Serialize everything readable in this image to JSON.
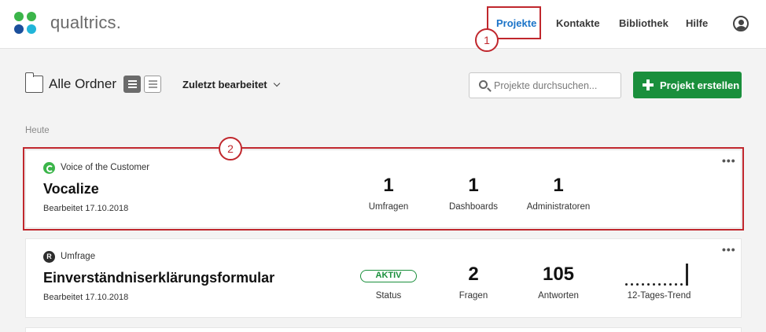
{
  "header": {
    "brand": "qualtrics.",
    "nav": [
      "Projekte",
      "Kontakte",
      "Bibliothek",
      "Hilfe"
    ],
    "active_nav": "Projekte"
  },
  "annotations": {
    "callout1": "1",
    "callout2": "2"
  },
  "toolbar": {
    "folder_label": "Alle Ordner",
    "sort_label": "Zuletzt bearbeitet",
    "search_placeholder": "Projekte durchsuchen...",
    "create_label": "Projekt erstellen"
  },
  "section_label": "Heute",
  "projects": [
    {
      "type_icon": "vocalize-icon",
      "type": "Voice of the Customer",
      "name": "Vocalize",
      "edited": "Bearbeitet 17.10.2018",
      "stats": [
        {
          "value": "1",
          "label": "Umfragen"
        },
        {
          "value": "1",
          "label": "Dashboards"
        },
        {
          "value": "1",
          "label": "Administratoren"
        }
      ]
    },
    {
      "type_icon": "survey-icon",
      "type_badge": "R",
      "type": "Umfrage",
      "name": "Einverständniserklärungsformular",
      "edited": "Bearbeitet 17.10.2018",
      "status": "AKTIV",
      "status_label": "Status",
      "stats": [
        {
          "value": "2",
          "label": "Fragen"
        },
        {
          "value": "105",
          "label": "Antworten"
        }
      ],
      "trend_label": "12-Tages-Trend",
      "trend": [
        0,
        0,
        0,
        0,
        0,
        0,
        0,
        0,
        0,
        0,
        0,
        105
      ]
    }
  ],
  "colors": {
    "accent_green": "#1a8f3c",
    "nav_active": "#1a73c8",
    "annotation_red": "#c0272d"
  }
}
